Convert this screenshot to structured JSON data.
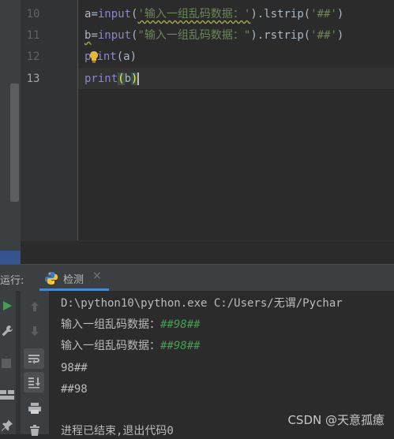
{
  "editor": {
    "line_numbers": [
      "10",
      "11",
      "12",
      "13"
    ],
    "lines": [
      {
        "a": "a",
        "b": "=",
        "fn": "input",
        "p1": "(",
        "str": "'输入一组乱码数据：'",
        "rest": ").lstrip(",
        "arg": "'##'",
        "end": ")"
      },
      {
        "a": "b",
        "b": "=",
        "fn": "input",
        "p1": "(",
        "str": "\"输入一组乱码数据：\"",
        "rest": ").rstrip(",
        "arg": "'##'",
        "end": ")"
      },
      {
        "fn_pre": "p",
        "fn_post": "int",
        "open": "(",
        "var": "a",
        "close": ")"
      },
      {
        "fn": "print",
        "open": "(",
        "var": "b",
        "close": ")"
      }
    ]
  },
  "run_panel": {
    "label": "运行:",
    "tab_label": "检测",
    "tab_close": "×"
  },
  "console": {
    "command": "D:\\python10\\python.exe C:/Users/无谓/Pychar",
    "prompt": "输入一组乱码数据：",
    "input1": "##98##",
    "input2": "##98##",
    "out1": "98##",
    "out2": "##98",
    "exit": "进程已结束,退出代码0"
  },
  "colors": {
    "background": "#2b2b2b",
    "keyword_fn": "#8888c6",
    "string": "#6a8759",
    "user_input": "#499c54",
    "accent": "#4a88c7"
  },
  "icons": [
    "run-icon",
    "wrench-icon",
    "stop-icon",
    "layout-icon",
    "pin-icon",
    "arrow-up-icon",
    "arrow-down-icon",
    "soft-wrap-icon",
    "scroll-to-end-icon",
    "print-icon",
    "trash-icon",
    "python-icon",
    "lightbulb-icon"
  ],
  "watermark": "CSDN @天意孤癔"
}
